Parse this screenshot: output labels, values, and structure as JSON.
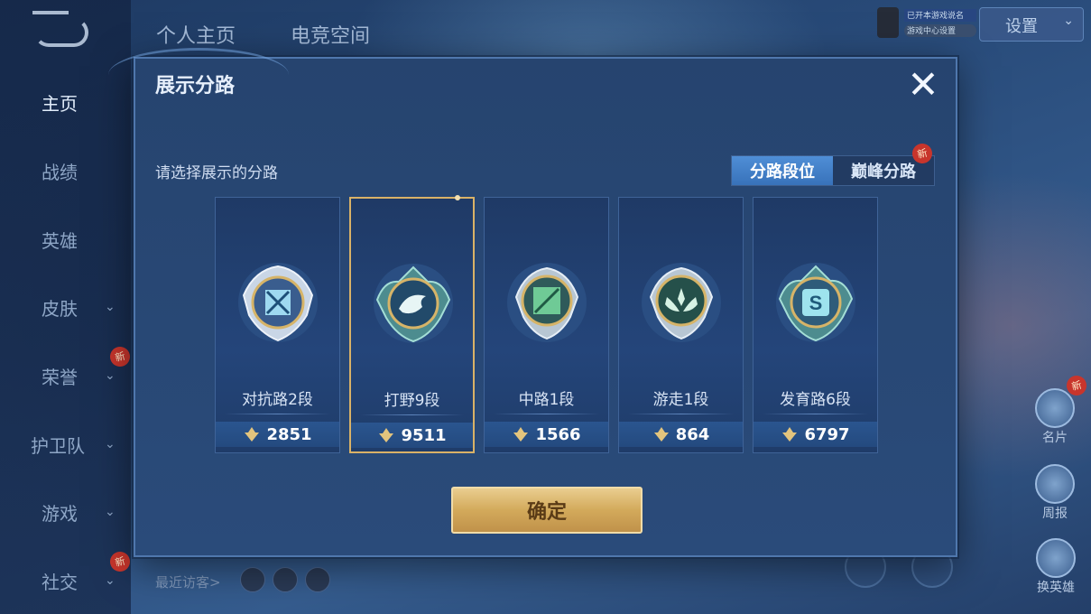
{
  "sidebar": {
    "items": [
      {
        "label": "主页",
        "active": true
      },
      {
        "label": "战绩"
      },
      {
        "label": "英雄"
      },
      {
        "label": "皮肤",
        "chevron": "⌄"
      },
      {
        "label": "荣誉",
        "chevron": "⌄",
        "badge": "新"
      },
      {
        "label": "护卫队",
        "chevron": "⌄"
      },
      {
        "label": "游戏",
        "chevron": "⌄"
      },
      {
        "label": "社交",
        "chevron": "⌄",
        "badge": "新"
      }
    ]
  },
  "top_tabs": [
    "个人主页",
    "电竞空间"
  ],
  "top_right": {
    "settings_label": "设置",
    "status_line1": "已开本游戏说名",
    "status_line2": "游戏中心设置"
  },
  "right_buttons": [
    {
      "label": "名片",
      "badge": "新"
    },
    {
      "label": "周报"
    },
    {
      "label": "换英雄"
    }
  ],
  "bottom": {
    "recent_visitors": "最近访客>"
  },
  "modal": {
    "title": "展示分路",
    "close_icon": "close-icon",
    "prompt": "请选择展示的分路",
    "toggle": {
      "options": [
        "分路段位",
        "巅峰分路"
      ],
      "selected": 0,
      "badge": "新"
    },
    "lanes": [
      {
        "name": "对抗路2段",
        "score": "2851",
        "icon": "crossed-swords-emblem",
        "selected": false
      },
      {
        "name": "打野9段",
        "score": "9511",
        "icon": "dragon-emblem",
        "selected": true
      },
      {
        "name": "中路1段",
        "score": "1566",
        "icon": "staff-emblem",
        "selected": false
      },
      {
        "name": "游走1段",
        "score": "864",
        "icon": "wings-emblem",
        "selected": false
      },
      {
        "name": "发育路6段",
        "score": "6797",
        "icon": "s-emblem",
        "selected": false
      }
    ],
    "confirm_label": "确定"
  },
  "colors": {
    "accent_gold": "#d9b267",
    "toggle_selected": "#4f8ed6",
    "badge_red": "#c8352c"
  }
}
